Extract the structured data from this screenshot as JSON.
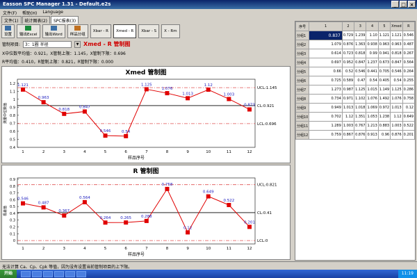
{
  "window": {
    "title": "Easson SPC Manager 1.31 - Default.e2s",
    "min": "_",
    "max": "□",
    "close": "×"
  },
  "menu": [
    "文件(F)",
    "帮助(H)",
    "Language"
  ],
  "tabs": [
    "文件(1)",
    "统计图表(2)",
    "SPC报表(3)"
  ],
  "toolbar": [
    "设置",
    "输出Excel",
    "输出Word",
    "样品分组",
    "Xbar - R",
    "Xmed - R",
    "Xbar - S",
    "X - Rm"
  ],
  "control_item": {
    "label": "管制项目:",
    "value": "3：1圈 半径",
    "arrow": "▼"
  },
  "chart_name": "Xmed - R 管制图",
  "stats": {
    "line1": "X中位数平均值：0.921，X管制上限：1.145，X管制下限：0.696",
    "line2": "R平均值：0.410，R管制上限：0.821，R管制下限：0.000"
  },
  "colors": {
    "center_line": "#000000",
    "limit_line": "#e05050",
    "series": "#e00000",
    "label": "#2020c0"
  },
  "chart_data": [
    {
      "type": "line",
      "title": "Xmed 管制图",
      "xlabel": "样品序号",
      "ylabel": "测量中位数值",
      "x": [
        1,
        2,
        3,
        4,
        5,
        6,
        7,
        8,
        9,
        10,
        11,
        12
      ],
      "values": [
        1.121,
        0.963,
        0.818,
        0.847,
        0.546,
        0.54,
        1.125,
        1.076,
        1.013,
        1.12,
        1.003,
        0.873
      ],
      "ucl": 1.145,
      "cl": 0.921,
      "lcl": 0.696,
      "limit_labels": [
        "UCL:1.145",
        "CL:0.921",
        "LCL:0.696"
      ],
      "ylim": [
        0.4,
        1.25
      ],
      "yticks": [
        0.4,
        0.5,
        0.6,
        0.7,
        0.8,
        0.9,
        1,
        1.1,
        1.2
      ],
      "xticks": [
        1,
        2,
        3,
        4,
        5,
        6,
        7,
        8,
        9,
        10,
        11,
        12
      ]
    },
    {
      "type": "line",
      "title": "R 管制图",
      "xlabel": "样品序号",
      "ylabel": "极差值",
      "x": [
        1,
        2,
        3,
        4,
        5,
        6,
        7,
        8,
        9,
        10,
        11,
        12
      ],
      "values": [
        0.546,
        0.487,
        0.367,
        0.564,
        0.264,
        0.265,
        0.288,
        0.758,
        0.12,
        0.649,
        0.522,
        0.201
      ],
      "ucl": 0.821,
      "cl": 0.41,
      "lcl": 0,
      "limit_labels": [
        "UCL:0.821",
        "CL:0.41",
        "LCL:0"
      ],
      "ylim": [
        -0.05,
        0.92
      ],
      "yticks": [
        0,
        0.1,
        0.2,
        0.3,
        0.4,
        0.5,
        0.6,
        0.7,
        0.8,
        0.9
      ],
      "xticks": [
        1,
        2,
        3,
        4,
        5,
        6,
        7,
        8,
        9,
        10,
        11,
        12
      ]
    }
  ],
  "table": {
    "headers": [
      "序号",
      "1",
      "2",
      "3",
      "4",
      "5",
      "Xmed",
      "R"
    ],
    "rows": [
      [
        "分组1",
        "0.837",
        "0.729",
        "1.239",
        "1.10",
        "1.121",
        "1.121",
        "0.546"
      ],
      [
        "分组2",
        "1.079",
        "0.876",
        "1.363",
        "0.938",
        "0.963",
        "0.963",
        "0.487"
      ],
      [
        "分组3",
        "0.614",
        "0.723",
        "0.818",
        "0.99",
        "0.941",
        "0.818",
        "0.267"
      ],
      [
        "分组4",
        "0.697",
        "0.952",
        "0.847",
        "1.237",
        "0.673",
        "0.847",
        "0.564"
      ],
      [
        "分组5",
        "0.66",
        "0.52",
        "0.546",
        "0.441",
        "0.705",
        "0.546",
        "0.264"
      ],
      [
        "分组6",
        "0.725",
        "0.589",
        "0.47",
        "0.54",
        "0.405",
        "0.54",
        "0.255"
      ],
      [
        "分组7",
        "1.273",
        "0.987",
        "1.125",
        "1.015",
        "1.149",
        "1.125",
        "0.286"
      ],
      [
        "分组8",
        "0.734",
        "0.971",
        "1.102",
        "1.076",
        "1.492",
        "1.076",
        "0.758"
      ],
      [
        "分组9",
        "0.949",
        "1.013",
        "1.018",
        "1.069",
        "0.972",
        "1.013",
        "0.12"
      ],
      [
        "分组10",
        "0.702",
        "1.12",
        "1.351",
        "1.053",
        "1.238",
        "1.12",
        "0.649"
      ],
      [
        "分组11",
        "1.289",
        "1.003",
        "0.767",
        "1.213",
        "0.883",
        "1.003",
        "0.522"
      ],
      [
        "分组12",
        "0.759",
        "0.867",
        "0.876",
        "0.913",
        "0.96",
        "0.876",
        "0.201"
      ]
    ]
  },
  "status_text": "无法计算 Ca、Cp、Cpk 等值，因为没有设置当前管制项目的上下限。",
  "taskbar": {
    "start": "开始",
    "clock": "11:19"
  }
}
